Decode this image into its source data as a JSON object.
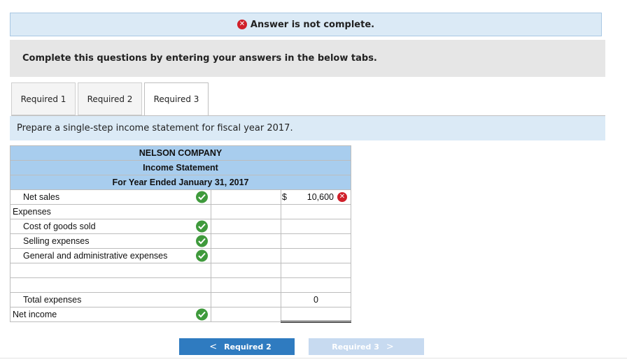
{
  "banner": {
    "status_icon": "x-circle-icon",
    "text": "Answer is not complete."
  },
  "instructions": "Complete this questions by entering your answers in the below tabs.",
  "tabs": [
    {
      "label": "Required 1"
    },
    {
      "label": "Required 2"
    },
    {
      "label": "Required 3",
      "active": true
    }
  ],
  "prompt": "Prepare a single-step income statement for fiscal year 2017.",
  "statement": {
    "company": "NELSON COMPANY",
    "title": "Income Statement",
    "period": "For Year Ended January 31, 2017",
    "rows": {
      "net_sales": {
        "label": "Net sales",
        "currency": "$",
        "value": "10,600",
        "status": "incorrect"
      },
      "expenses": {
        "label": "Expenses"
      },
      "cogs": {
        "label": "Cost of goods sold"
      },
      "selling": {
        "label": "Selling expenses"
      },
      "gen_admin": {
        "label": "General and administrative expenses"
      },
      "total_expenses": {
        "label": "Total expenses",
        "value": "0"
      },
      "net_income": {
        "label": "Net income"
      }
    }
  },
  "navigation": {
    "prev": {
      "arrow": "<",
      "label": "Required 2"
    },
    "next": {
      "label": "Required 3",
      "arrow": ">"
    }
  },
  "colors": {
    "correct": "#3f9a3c",
    "incorrect": "#d0202a",
    "header": "#a8cdee",
    "banner": "#dbeaf6"
  }
}
